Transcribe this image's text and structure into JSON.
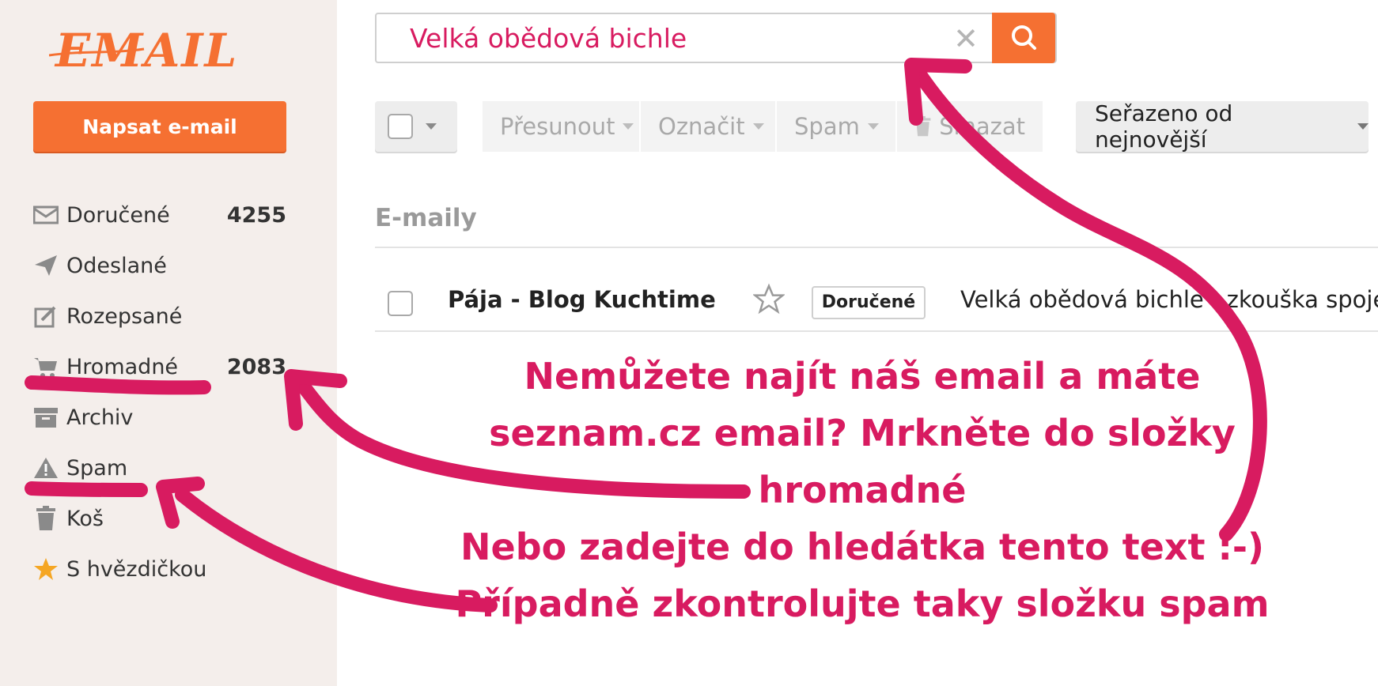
{
  "brand": {
    "logo_text": "EMAIL",
    "accent": "#f57032",
    "annotation_color": "#d81b60"
  },
  "sidebar": {
    "compose_label": "Napsat e-mail",
    "folders": [
      {
        "label": "Doručené",
        "count": "4255",
        "icon": "envelope-icon"
      },
      {
        "label": "Odeslané",
        "count": "",
        "icon": "paper-plane-icon"
      },
      {
        "label": "Rozepsané",
        "count": "",
        "icon": "edit-icon"
      },
      {
        "label": "Hromadné",
        "count": "2083",
        "icon": "cart-icon"
      },
      {
        "label": "Archiv",
        "count": "",
        "icon": "archive-box-icon"
      },
      {
        "label": "Spam",
        "count": "",
        "icon": "warning-triangle-icon"
      },
      {
        "label": "Koš",
        "count": "",
        "icon": "trash-icon"
      },
      {
        "label": "S hvězdičkou",
        "count": "",
        "icon": "star-icon"
      }
    ]
  },
  "search": {
    "value": "Velká obědová bichle",
    "clear_icon": "close-icon",
    "button_icon": "search-icon"
  },
  "toolbar": {
    "move_label": "Přesunout",
    "mark_label": "Označit",
    "spam_label": "Spam",
    "delete_label": "Smazat",
    "sort_label": "Seřazeno od nejnovější"
  },
  "list": {
    "section_title": "E-maily",
    "rows": [
      {
        "sender": "Pája - Blog Kuchtime",
        "folder_badge": "Doručené",
        "subject": "Velká obědová bichle - zkouška spojení a"
      }
    ]
  },
  "annotation": {
    "lines": [
      "Nemůžete najít náš email a máte",
      "seznam.cz email? Mrkněte do složky",
      "hromadné",
      "Nebo zadejte do hledátka tento text :-)",
      "Případně zkontrolujte taky složku spam"
    ]
  }
}
